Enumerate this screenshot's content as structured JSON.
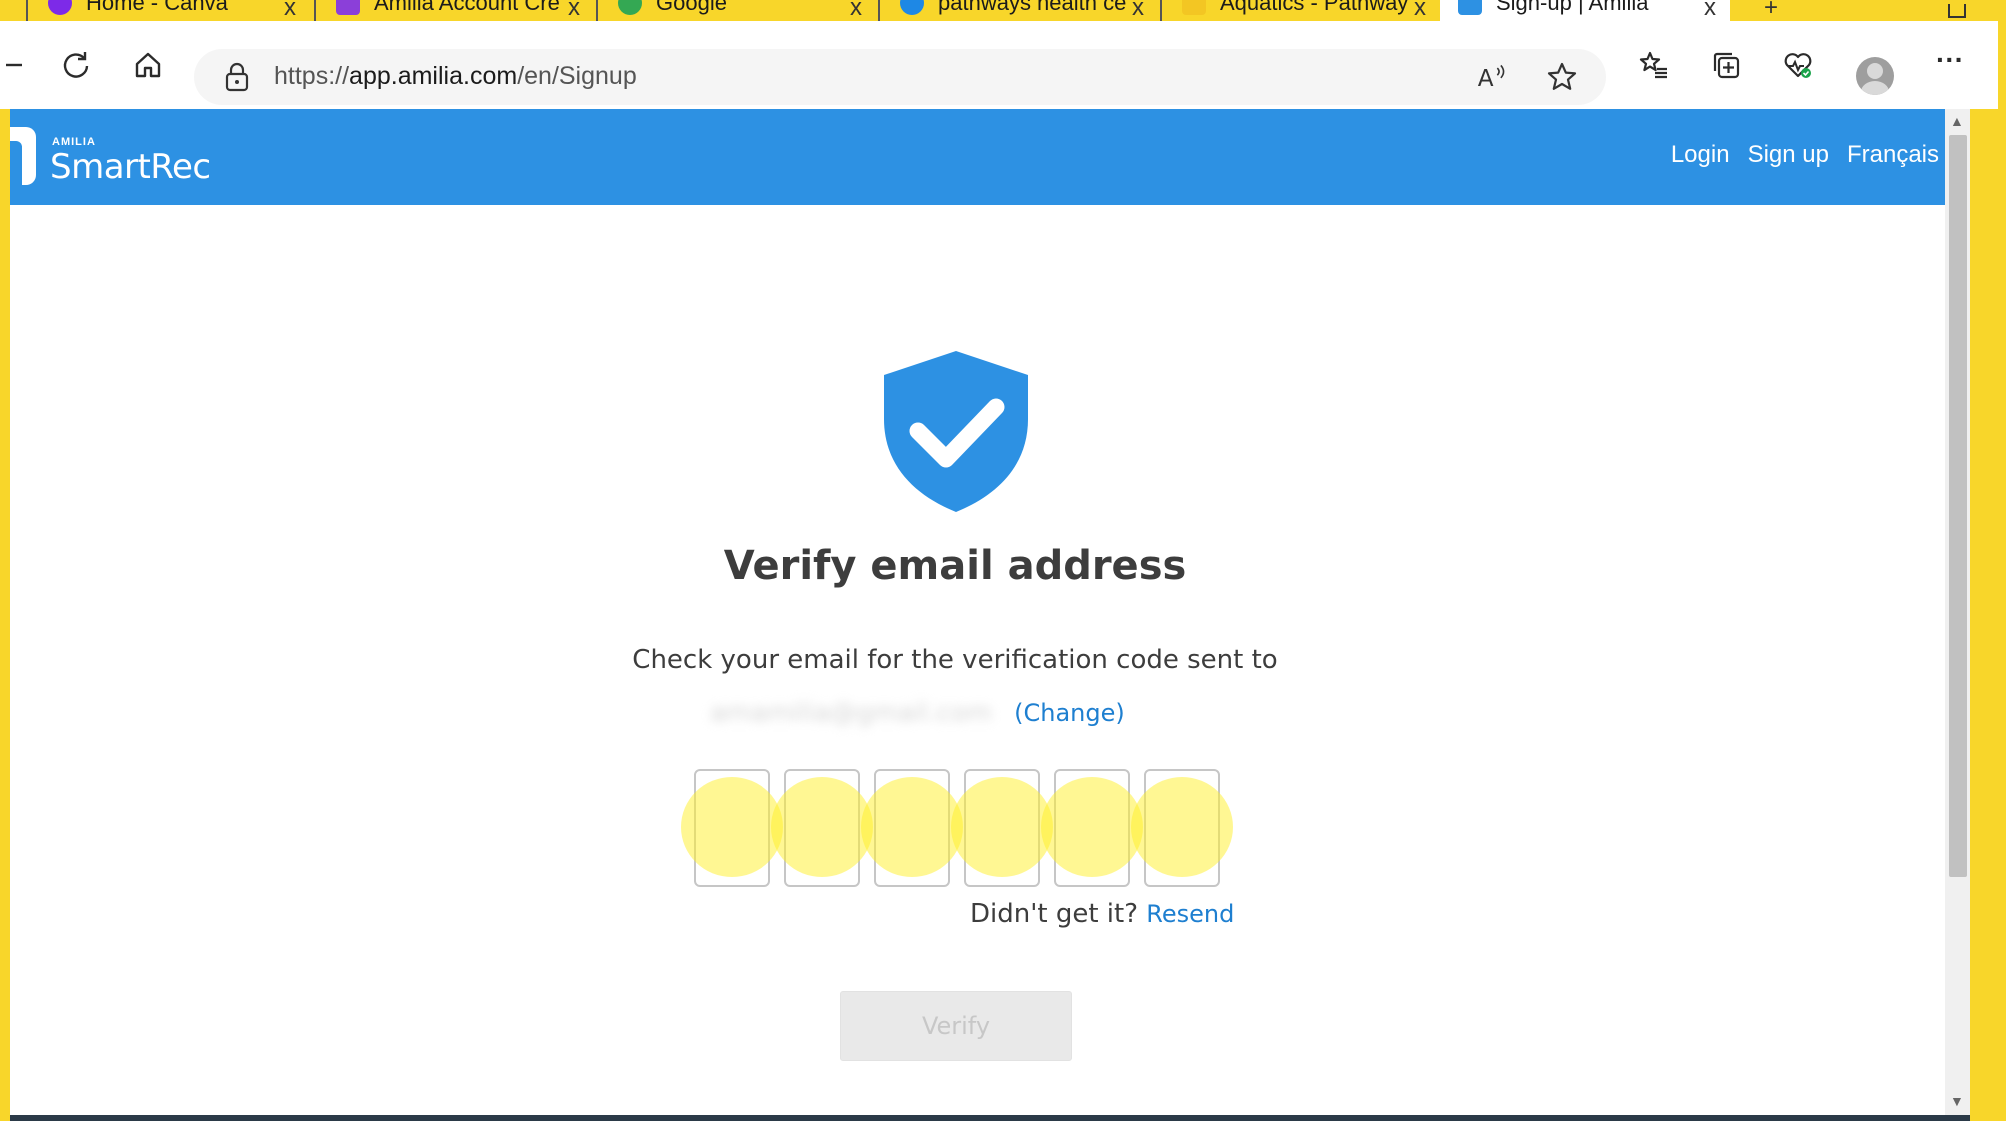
{
  "browser": {
    "tabs": [
      {
        "title": "Home - Canva",
        "favicon_color": "#7d2ae8"
      },
      {
        "title": "Amilia Account Cre",
        "favicon_color": "#8b3fd9"
      },
      {
        "title": "Google",
        "favicon_color": "#34a853"
      },
      {
        "title": "pathways health ce",
        "favicon_color": "#1e88e5"
      },
      {
        "title": "Aquatics - Pathway",
        "favicon_color": "#f3c623"
      },
      {
        "title": "Sign-up | Amilia",
        "favicon_color": "#2d91e3",
        "active": true
      }
    ],
    "tab_close_glyph": "x",
    "new_tab_glyph": "+",
    "address": {
      "scheme": "https://",
      "host": "app.amilia.com",
      "path": "/en/Signup"
    },
    "icons": {
      "back": "back-arrow-icon",
      "refresh": "refresh-icon",
      "home": "home-icon",
      "lock": "lock-icon",
      "read_aloud": "read-aloud-icon",
      "favorite": "star-icon",
      "favorites": "favorites-list-icon",
      "collections": "collections-icon",
      "health": "browser-essentials-icon",
      "profile": "profile-avatar-icon",
      "more": "more-menu-icon"
    },
    "more_glyph": "···",
    "read_aloud_glyph": "A⁡"
  },
  "site": {
    "brand_small": "AMILIA",
    "brand": "SmartRec",
    "nav": {
      "login": "Login",
      "signup": "Sign up",
      "language": "Français"
    },
    "primary_color": "#2d91e3",
    "link_color": "#1e7fd0"
  },
  "verify": {
    "title": "Verify email address",
    "message": "Check your email for the verification code sent to",
    "email_blurred": "amamilia@gmail.com",
    "change_label": "(Change)",
    "code_boxes": [
      "",
      "",
      "",
      "",
      "",
      ""
    ],
    "resend_prompt": "Didn't get it?",
    "resend_label": "Resend",
    "verify_label": "Verify"
  }
}
